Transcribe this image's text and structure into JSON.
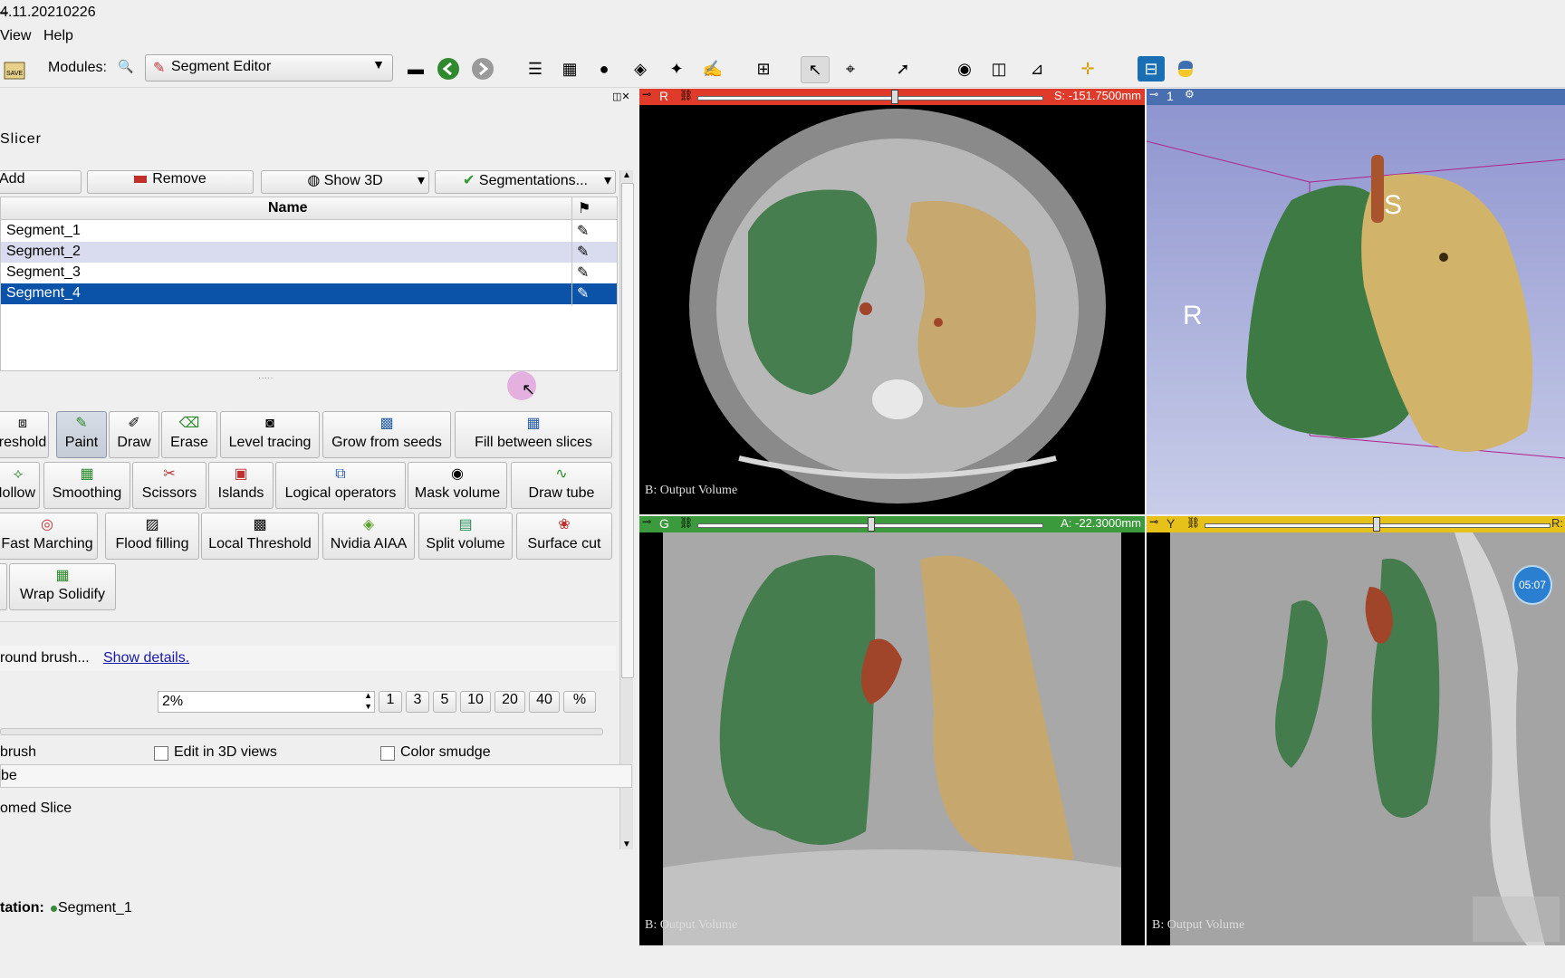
{
  "window": {
    "title": "4.11.20210226",
    "minimize": "–"
  },
  "menu": {
    "view": "View",
    "help": "Help"
  },
  "toolbar": {
    "modules_label": "Modules:",
    "module_selected": "Segment Editor",
    "save_label": "SAVE"
  },
  "module_header": {
    "title": "Slicer"
  },
  "segment_actions": {
    "add": "Add",
    "remove": "Remove",
    "show3d": "Show 3D",
    "segmentations": "Segmentations..."
  },
  "segments_table": {
    "column_name": "Name",
    "rows": [
      {
        "name": "Segment_1",
        "color": "#3b8a3b"
      },
      {
        "name": "Segment_2",
        "color": "#e8c87a"
      },
      {
        "name": "Segment_3",
        "color": "#b34d2a"
      },
      {
        "name": "Segment_4",
        "color": "#3c6ec8"
      }
    ],
    "selected_row": "Segment_4"
  },
  "effects": {
    "row1": [
      "Threshold",
      "Paint",
      "Draw",
      "Erase",
      "Level tracing",
      "Grow from seeds",
      "Fill between slices"
    ],
    "row1_visible": [
      "reshold",
      "Paint",
      "Draw",
      "Erase",
      "Level tracing",
      "Grow from seeds",
      "Fill between slices"
    ],
    "row2_visible": [
      "Hollow",
      "Smoothing",
      "Scissors",
      "Islands",
      "Logical operators",
      "Mask volume",
      "Draw tube"
    ],
    "row2_display": [
      "Hollow",
      "Smoothing",
      "Scissors",
      "Islands",
      "Logical operators",
      "Mask volume",
      "Draw tube"
    ],
    "row3": [
      "Fast Marching",
      "Flood filling",
      "Local Threshold",
      "Nvidia AIAA",
      "Split volume",
      "Surface cut"
    ],
    "row4": [
      "Wrap Solidify"
    ],
    "hollow_clip": "Hollow"
  },
  "paint_options": {
    "help_text": "round brush...",
    "show_details": "Show details.",
    "diameter_value": "2%",
    "presets": [
      "1",
      "3",
      "5",
      "10",
      "20",
      "40",
      "%"
    ],
    "sphere_brush_label": "brush",
    "edit_3d_label": "Edit in 3D views",
    "color_smudge_label": "Color smudge",
    "section_label": "be",
    "zoomed_slice": "omed Slice",
    "annotation_label": "tation:",
    "annotation_segment": "Segment_1"
  },
  "views": {
    "red": {
      "letter": "R",
      "offset": "S: -151.7500mm",
      "volume_label": "B: Output Volume"
    },
    "green": {
      "letter": "G",
      "offset": "A: -22.3000mm",
      "volume_label": "B: Output Volume"
    },
    "yellow": {
      "letter": "Y",
      "offset": "R:",
      "volume_label": "B: Output Volume"
    },
    "threed": {
      "letter": "1",
      "label_top": "S",
      "label_left": "R"
    },
    "timer": "05:07"
  },
  "colors": {
    "red_bar": "#e03a2a",
    "green_bar": "#3b9a3b",
    "yellow_bar": "#e6c11a",
    "threed_bar": "#4a6fb0",
    "selection": "#0a53a8"
  }
}
